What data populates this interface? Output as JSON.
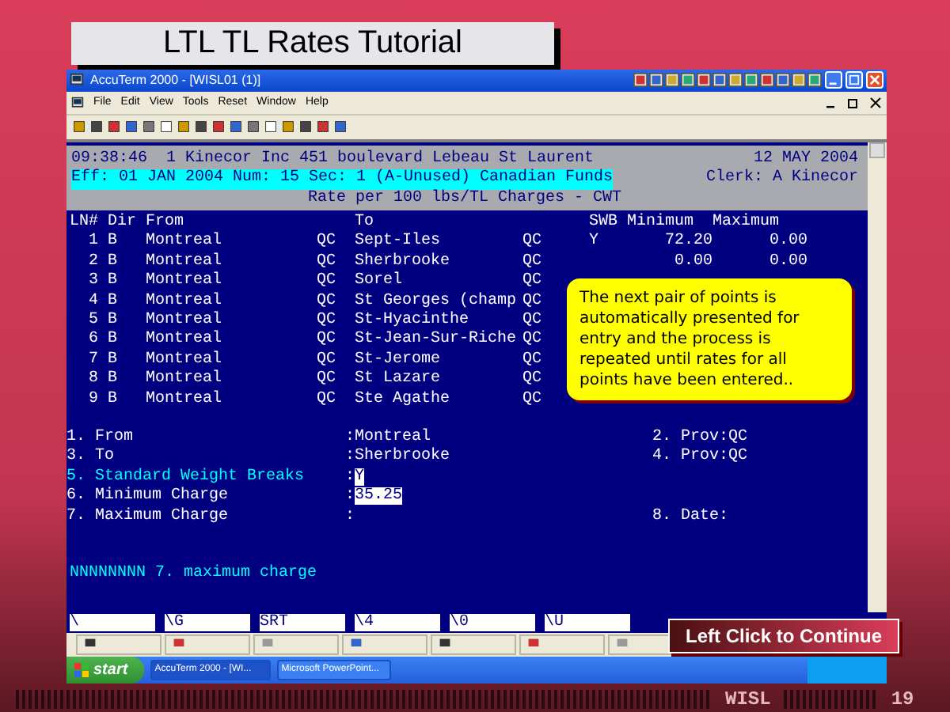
{
  "slide_title": "LTL TL Rates Tutorial",
  "window": {
    "title": "AccuTerm 2000 - [WISL01 (1)]",
    "menu": [
      "File",
      "Edit",
      "View",
      "Tools",
      "Reset",
      "Window",
      "Help"
    ]
  },
  "terminal": {
    "time_line": "09:38:46  1 Kinecor Inc 451 boulevard Lebeau St Laurent",
    "date": "12 MAY 2004",
    "eff_line": "Eff: 01 JAN 2004 Num: 15 Sec: 1 (A-Unused) Canadian Funds",
    "clerk": "Clerk: A Kinecor",
    "rate_line": "Rate per 100 lbs/TL Charges - CWT",
    "columns": [
      "LN#",
      "Dir",
      "From",
      "To",
      "SWB",
      "Minimum",
      "Maximum"
    ],
    "rows": [
      {
        "ln": "1",
        "dir": "B",
        "from": "Montreal",
        "from_prov": "QC",
        "to": "Sept-Iles",
        "to_prov": "QC",
        "swb": "Y",
        "minimum": "72.20",
        "maximum": "0.00"
      },
      {
        "ln": "2",
        "dir": "B",
        "from": "Montreal",
        "from_prov": "QC",
        "to": "Sherbrooke",
        "to_prov": "QC",
        "minimum": "0.00",
        "maximum": "0.00"
      },
      {
        "ln": "3",
        "dir": "B",
        "from": "Montreal",
        "from_prov": "QC",
        "to": "Sorel",
        "to_prov": "QC"
      },
      {
        "ln": "4",
        "dir": "B",
        "from": "Montreal",
        "from_prov": "QC",
        "to": "St Georges (champ",
        "to_prov": "QC"
      },
      {
        "ln": "5",
        "dir": "B",
        "from": "Montreal",
        "from_prov": "QC",
        "to": "St-Hyacinthe",
        "to_prov": "QC"
      },
      {
        "ln": "6",
        "dir": "B",
        "from": "Montreal",
        "from_prov": "QC",
        "to": "St-Jean-Sur-Riche",
        "to_prov": "QC"
      },
      {
        "ln": "7",
        "dir": "B",
        "from": "Montreal",
        "from_prov": "QC",
        "to": "St-Jerome",
        "to_prov": "QC"
      },
      {
        "ln": "8",
        "dir": "B",
        "from": "Montreal",
        "from_prov": "QC",
        "to": "St Lazare",
        "to_prov": "QC"
      },
      {
        "ln": "9",
        "dir": "B",
        "from": "Montreal",
        "from_prov": "QC",
        "to": "Ste Agathe",
        "to_prov": "QC"
      }
    ],
    "form": [
      {
        "label": "1. From",
        "colon": ":",
        "value": "Montreal",
        "right": "2. Prov:QC",
        "active": false,
        "highlighted": false
      },
      {
        "label": "3. To",
        "colon": ":",
        "value": "Sherbrooke",
        "right": "4. Prov:QC",
        "active": false,
        "highlighted": false
      },
      {
        "label": "5. Standard Weight Breaks",
        "colon": ":",
        "value": "Y",
        "active": true,
        "highlighted": true
      },
      {
        "label": "6. Minimum Charge",
        "colon": ":",
        "value": "35.25",
        "active": false,
        "highlighted": true
      },
      {
        "label": "7. Maximum Charge",
        "colon": ":",
        "right": "8. Date:",
        "active": false
      }
    ],
    "message": "NNNNNNNN 7. maximum charge"
  },
  "function_keys": [
    "\\",
    "\\G",
    "SRT",
    "\\4",
    "\\0",
    "\\U"
  ],
  "callout": "The next pair of points is automatically presented for entry and the process is repeated until rates for all points have been entered..",
  "continue_button": "Left Click to Continue",
  "taskbar": {
    "start": "start",
    "tasks": [
      "AccuTerm 2000 - [WI...",
      "Microsoft PowerPoint..."
    ]
  },
  "footer": {
    "org": "WISL",
    "page": "19"
  }
}
